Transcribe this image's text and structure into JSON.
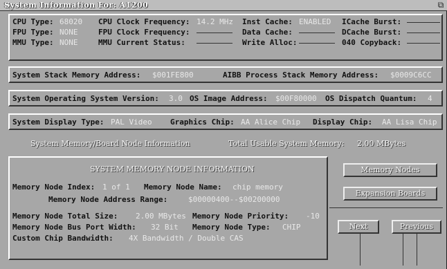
{
  "window": {
    "title": "System Information For: A1200"
  },
  "cpu": {
    "cpu_type_label": "CPU Type:",
    "cpu_type": "68020",
    "fpu_type_label": "FPU Type:",
    "fpu_type": "NONE",
    "mmu_type_label": "MMU Type:",
    "mmu_type": "NONE",
    "clock_label": "CPU Clock Frequency:",
    "clock": "14.2 MHz",
    "fpu_clock_label": "FPU Clock Frequency:",
    "mmu_status_label": "MMU Current Status:",
    "inst_cache_label": "Inst Cache:",
    "inst_cache": "ENABLED",
    "data_cache_label": "Data Cache:",
    "write_alloc_label": "Write Alloc:",
    "icache_burst_label": "ICache Burst:",
    "dcache_burst_label": "DCache Burst:",
    "copyback_label": "040 Copyback:"
  },
  "stack": {
    "system_stack_label": "System Stack Memory Address:",
    "system_stack": "$001FE800",
    "process_stack_label": "AIBB Process Stack Memory Address:",
    "process_stack": "$0009C6CC"
  },
  "os": {
    "version_label": "System Operating System Version:",
    "version": "3.0",
    "image_label": "OS Image Address:",
    "image": "$00F80000",
    "quantum_label": "OS Dispatch Quantum:",
    "quantum": "4"
  },
  "display": {
    "display_type_label": "System Display Type:",
    "display_type": "PAL Video",
    "graphics_chip_label": "Graphics Chip:",
    "graphics_chip": "AA Alice Chip",
    "display_chip_label": "Display Chip:",
    "display_chip": "AA Lisa Chip"
  },
  "memory_tab": {
    "title": "System Memory/Board Node Information",
    "total_label": "Total Usable System Memory:",
    "total": "2.00 MBytes"
  },
  "node": {
    "heading": "SYSTEM MEMORY NODE INFORMATION",
    "index_label": "Memory Node Index:",
    "index": "1 of 1",
    "name_label": "Memory Node Name:",
    "name": "chip memory",
    "range_label": "Memory Node Address Range:",
    "range": "$00000400--$00200000",
    "total_size_label": "Memory Node Total Size:",
    "total_size": "2.00 MBytes",
    "priority_label": "Memory Node Priority:",
    "priority": "-10",
    "bus_width_label": "Memory Node Bus Port Width:",
    "bus_width": "32 Bit",
    "type_label": "Memory Node Type:",
    "type": "CHIP",
    "bandwidth_label": "Custom Chip Bandwidth:",
    "bandwidth": "4X Bandwidth / Double CAS"
  },
  "buttons": {
    "memory_nodes": "Memory Nodes",
    "expansion_boards": "Expansion Boards",
    "next": "Next",
    "previous": "Previous"
  }
}
